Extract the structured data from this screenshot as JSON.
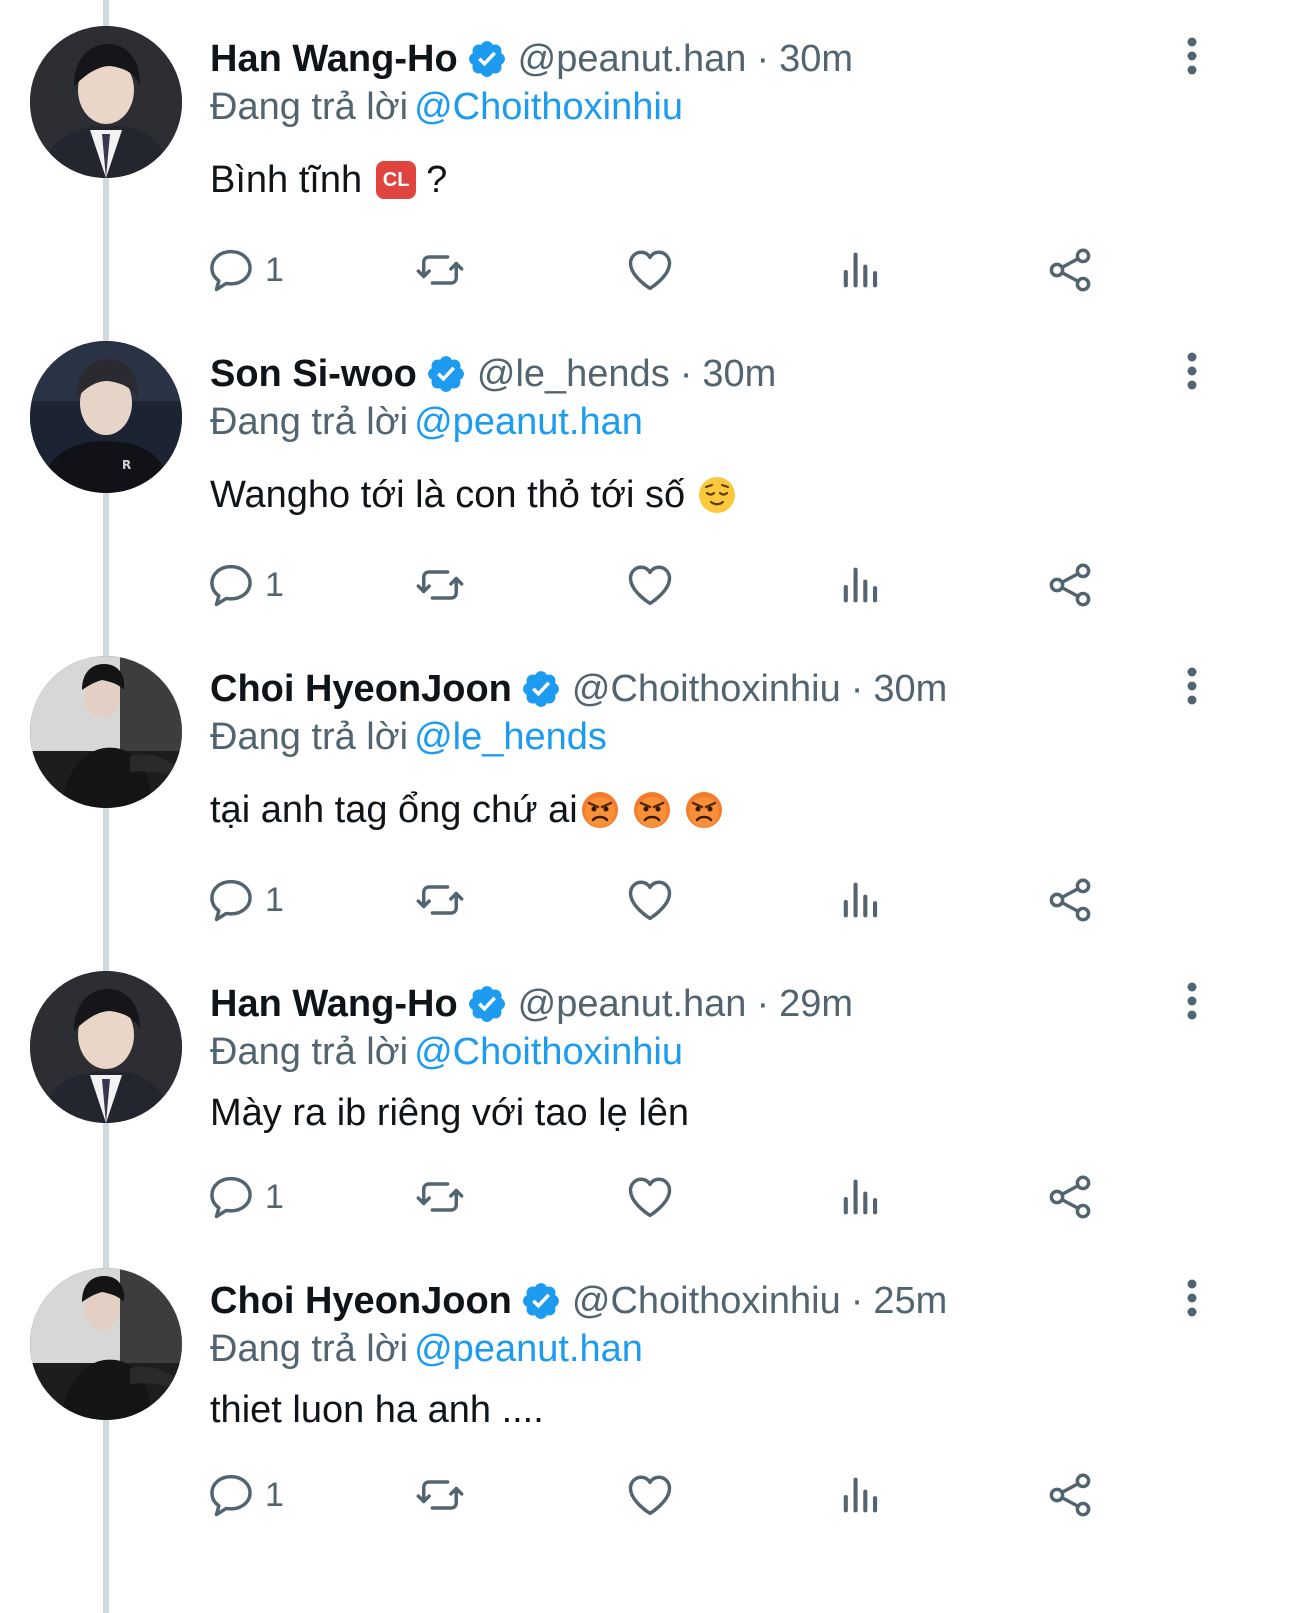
{
  "thread": {
    "reply_prefix": "Đang trả lời",
    "tweets": [
      {
        "name": "Han Wang-Ho",
        "handle": "@peanut.han",
        "separator": "·",
        "time": "30m",
        "reply_to": "@Choithoxinhiu",
        "text": "Bình tĩnh",
        "emoji_label": "CL",
        "text_suffix": "?",
        "reply_count": "1"
      },
      {
        "name": "Son Si-woo",
        "handle": "@le_hends",
        "separator": "·",
        "time": "30m",
        "reply_to": "@peanut.han",
        "text": "Wangho tới là con thỏ tới số",
        "reply_count": "1"
      },
      {
        "name": "Choi HyeonJoon",
        "handle": "@Choithoxinhiu",
        "separator": "·",
        "time": "30m",
        "reply_to": "@le_hends",
        "text": "tại anh tag ổng chứ ai",
        "reply_count": "1"
      },
      {
        "name": "Han Wang-Ho",
        "handle": "@peanut.han",
        "separator": "·",
        "time": "29m",
        "reply_to": "@Choithoxinhiu",
        "text": "Mày ra ib riêng với tao lẹ lên",
        "reply_count": "1"
      },
      {
        "name": "Choi HyeonJoon",
        "handle": "@Choithoxinhiu",
        "separator": "·",
        "time": "25m",
        "reply_to": "@peanut.han",
        "text": "thiet luon ha anh ....",
        "reply_count": "1"
      }
    ]
  },
  "colors": {
    "accent": "#1d9bf0",
    "secondary_text": "#536471",
    "primary_text": "#0f1419",
    "thread_line": "#cfd9de"
  },
  "icons": [
    "verified-badge-icon",
    "more-options-icon",
    "reply-icon",
    "retweet-icon",
    "like-icon",
    "views-icon",
    "share-icon",
    "cl-emoji-icon",
    "relieved-face-emoji-icon",
    "angry-face-emoji-icon"
  ]
}
